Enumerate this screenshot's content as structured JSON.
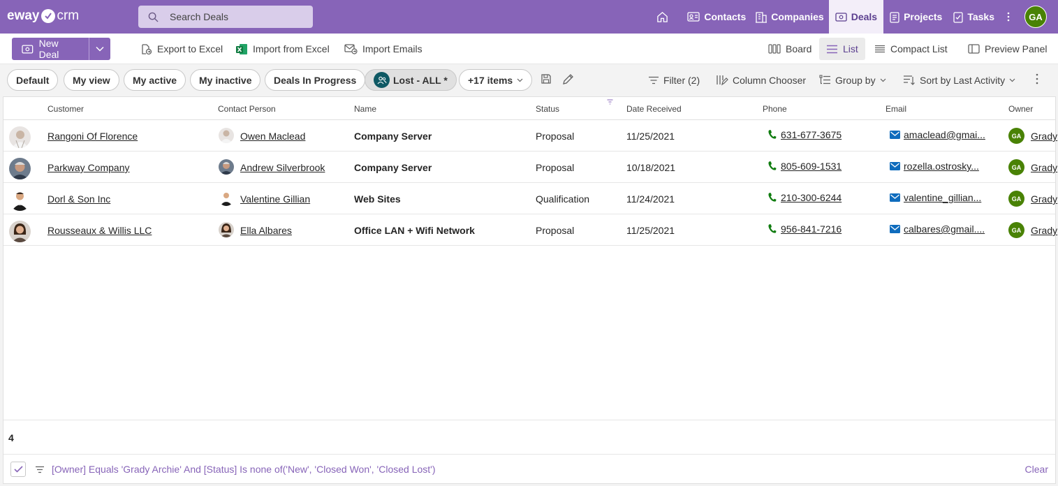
{
  "app": {
    "logo_left": "eway",
    "logo_right": "crm"
  },
  "search": {
    "placeholder": "Search Deals"
  },
  "nav": {
    "contacts": "Contacts",
    "companies": "Companies",
    "deals": "Deals",
    "projects": "Projects",
    "tasks": "Tasks",
    "user_initials": "GA"
  },
  "toolbar": {
    "new_deal": "New Deal",
    "export_excel": "Export to Excel",
    "import_excel": "Import from Excel",
    "import_emails": "Import Emails",
    "board": "Board",
    "list": "List",
    "compact_list": "Compact List",
    "preview_panel": "Preview Panel"
  },
  "views": {
    "default": "Default",
    "my_view": "My view",
    "my_active": "My active",
    "my_inactive": "My inactive",
    "in_progress": "Deals In Progress",
    "lost_all": "Lost - ALL *",
    "more": "+17 items"
  },
  "filters": {
    "filter": "Filter (2)",
    "column_chooser": "Column Chooser",
    "group_by": "Group by",
    "sort_by": "Sort by Last Activity"
  },
  "columns": {
    "customer": "Customer",
    "contact": "Contact Person",
    "name": "Name",
    "status": "Status",
    "date": "Date Received",
    "phone": "Phone",
    "email": "Email",
    "owner": "Owner"
  },
  "rows": [
    {
      "customer": "Rangoni Of Florence",
      "contact": "Owen Maclead",
      "name": "Company Server",
      "status": "Proposal",
      "date": "11/25/2021",
      "phone": "631-677-3675",
      "email": "amaclead@gmai...",
      "owner_initials": "GA",
      "owner": "Grady"
    },
    {
      "customer": "Parkway Company",
      "contact": "Andrew Silverbrook",
      "name": "Company Server",
      "status": "Proposal",
      "date": "10/18/2021",
      "phone": "805-609-1531",
      "email": "rozella.ostrosky...",
      "owner_initials": "GA",
      "owner": "Grady"
    },
    {
      "customer": "Dorl & Son Inc",
      "contact": "Valentine Gillian",
      "name": "Web Sites",
      "status": "Qualification",
      "date": "11/24/2021",
      "phone": "210-300-6244",
      "email": "valentine_gillian...",
      "owner_initials": "GA",
      "owner": "Grady"
    },
    {
      "customer": "Rousseaux & Willis LLC",
      "contact": "Ella Albares",
      "name": "Office LAN + Wifi Network",
      "status": "Proposal",
      "date": "11/25/2021",
      "phone": "956-841-7216",
      "email": "calbares@gmail....",
      "owner_initials": "GA",
      "owner": "Grady"
    }
  ],
  "footer": {
    "count": "4",
    "filter_expression": "[Owner] Equals 'Grady Archie' And [Status] Is none of('New', 'Closed Won', 'Closed Lost')",
    "clear": "Clear"
  },
  "colors": {
    "brand": "#8764b8",
    "owner_badge": "#498205",
    "phone_icon": "#107c10",
    "email_icon": "#0f6cbd"
  }
}
